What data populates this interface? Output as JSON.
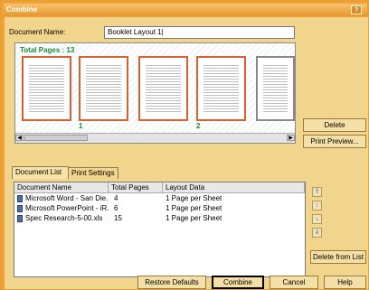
{
  "window": {
    "title": "Combine",
    "help_label": "?"
  },
  "document_name": {
    "label": "Document Name:",
    "value": "Booklet Layout 1|"
  },
  "preview": {
    "total_pages_label": "Total Pages : 13",
    "page_numbers": [
      "1",
      "2"
    ]
  },
  "side_buttons": {
    "delete": "Delete",
    "print_preview": "Print Preview..."
  },
  "tabs": [
    {
      "label": "Document List"
    },
    {
      "label": "Print Settings"
    }
  ],
  "list": {
    "columns": [
      "Document Name",
      "Total Pages",
      "Layout Data"
    ],
    "rows": [
      {
        "name": "Microsoft Word - San Die...",
        "pages": "4",
        "layout": "1 Page per Sheet"
      },
      {
        "name": "Microsoft PowerPoint - iR...",
        "pages": "6",
        "layout": "1 Page per Sheet"
      },
      {
        "name": "Spec Research-5-00.xls",
        "pages": "15",
        "layout": "1 Page per Sheet"
      }
    ]
  },
  "list_side_buttons": {
    "delete_from_list": "Delete from List"
  },
  "bottom_buttons": {
    "restore_defaults": "Restore Defaults",
    "combine": "Combine",
    "cancel": "Cancel",
    "help": "Help"
  },
  "colors": {
    "accent": "#f0a138",
    "total_pages": "#1a8a3a",
    "page_border": "#d8602e"
  }
}
